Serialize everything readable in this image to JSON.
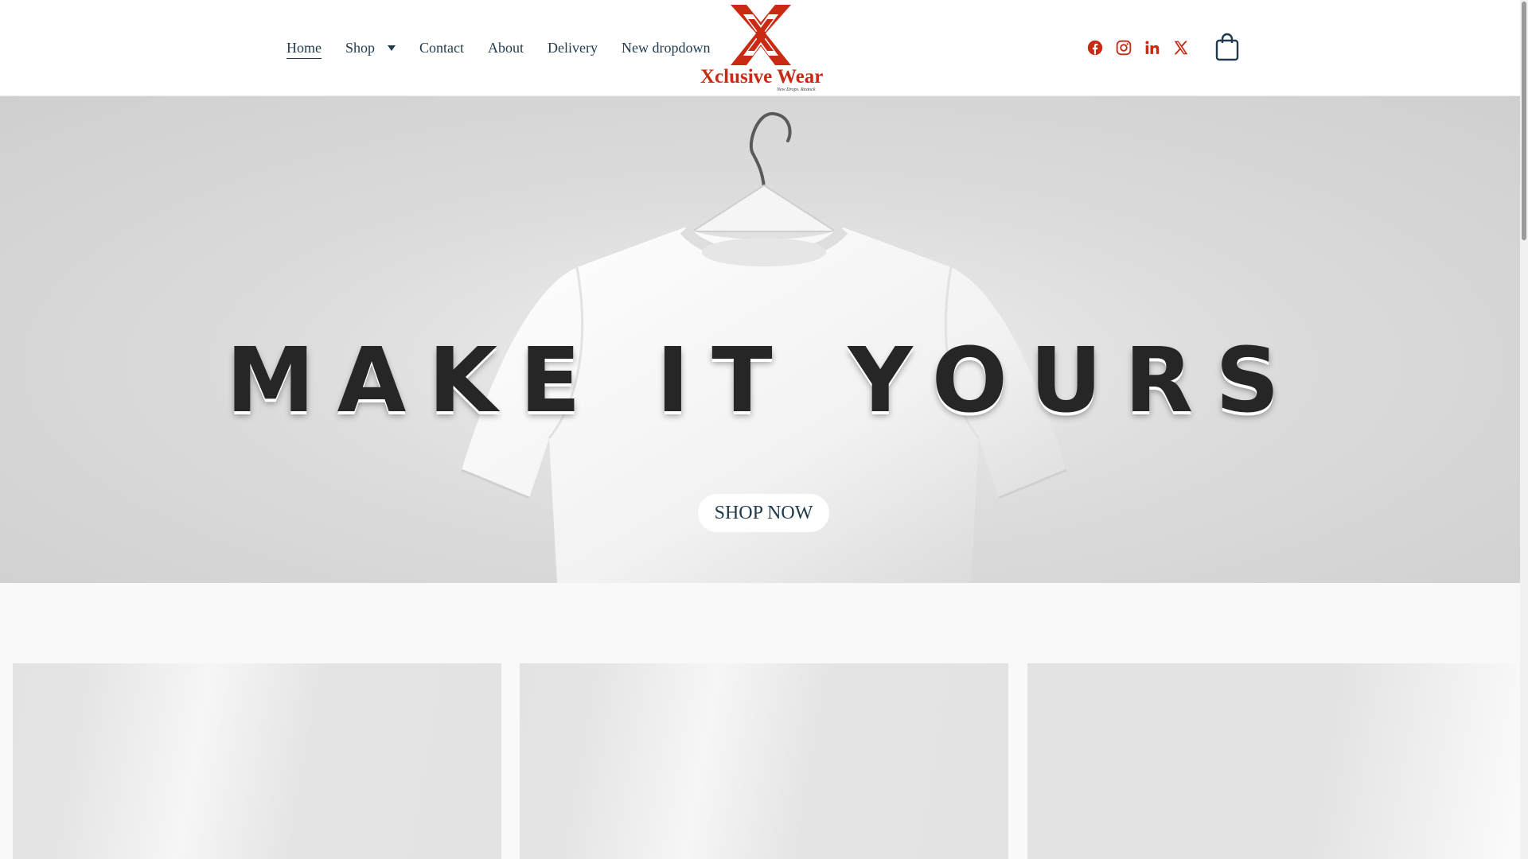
{
  "nav": {
    "items": [
      {
        "label": "Home",
        "active": true
      },
      {
        "label": "Shop",
        "dropdown": true
      },
      {
        "label": "Contact"
      },
      {
        "label": "About"
      },
      {
        "label": "Delivery"
      },
      {
        "label": "New dropdown"
      }
    ]
  },
  "logo": {
    "name": "Xclusive Wear",
    "tagline": "New Drops. Restock",
    "color": "#c92a14"
  },
  "socials": [
    {
      "icon": "facebook-icon"
    },
    {
      "icon": "instagram-icon"
    },
    {
      "icon": "linkedin-icon"
    },
    {
      "icon": "x-icon"
    }
  ],
  "social_color": "#c92a14",
  "cart": {
    "icon": "shopping-bag-icon"
  },
  "hero": {
    "title": "MAKE IT YOURS",
    "button_label": "SHOP NOW"
  },
  "products": [
    {
      "state": "loading"
    },
    {
      "state": "loading"
    },
    {
      "state": "loading"
    }
  ]
}
